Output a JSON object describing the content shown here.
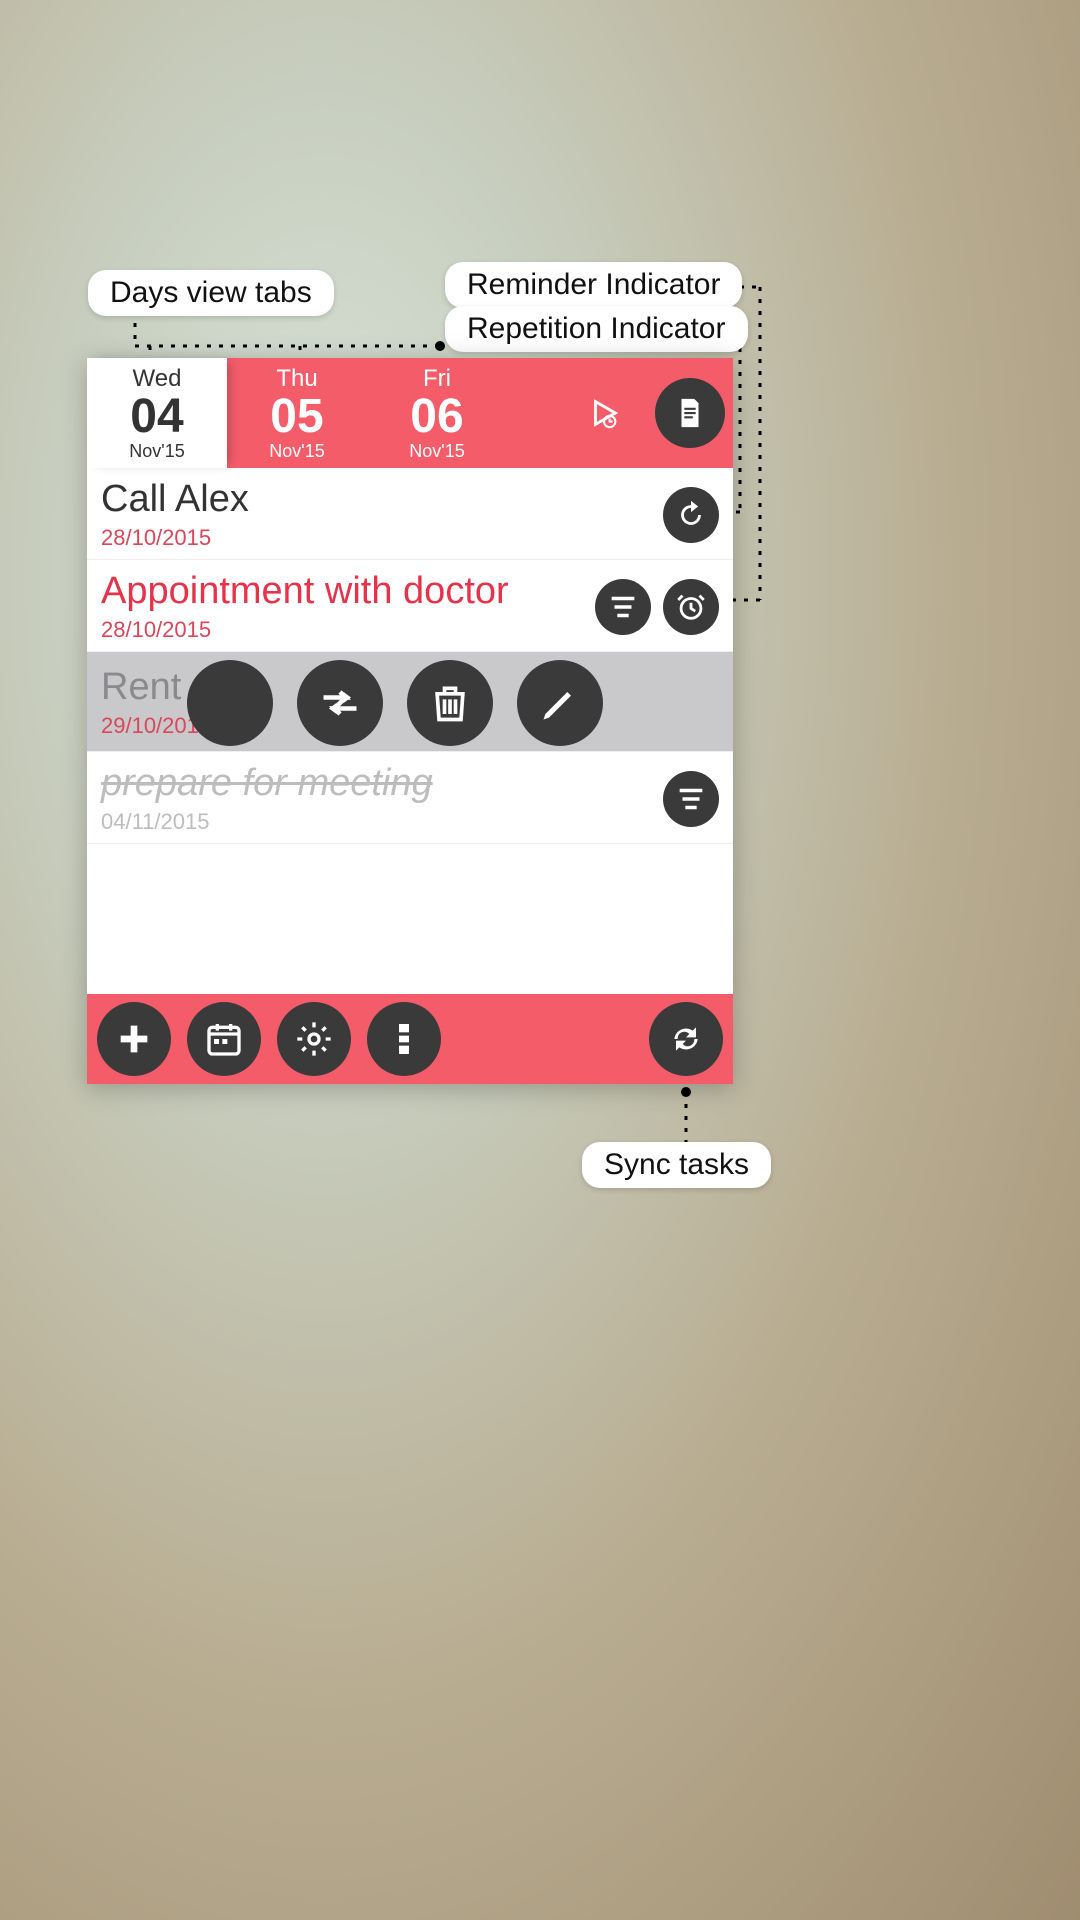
{
  "days": [
    {
      "dow": "Wed",
      "day": "04",
      "monyr": "Nov'15",
      "active": true
    },
    {
      "dow": "Thu",
      "day": "05",
      "monyr": "Nov'15",
      "active": false
    },
    {
      "dow": "Fri",
      "day": "06",
      "monyr": "Nov'15",
      "active": false
    }
  ],
  "tasks": [
    {
      "title": "Call Alex",
      "date": "28/10/2015"
    },
    {
      "title": "Appointment with doctor",
      "date": "28/10/2015"
    },
    {
      "title": "Rent",
      "date": "29/10/2015"
    },
    {
      "title": "prepare for meeting",
      "date": "04/11/2015"
    }
  ],
  "callouts": {
    "days_tabs": "Days view tabs",
    "reminder": "Reminder Indicator",
    "repetition": "Repetition Indicator",
    "move": "Move",
    "delete": "Delete",
    "edit": "Edit",
    "sync": "Sync tasks"
  }
}
